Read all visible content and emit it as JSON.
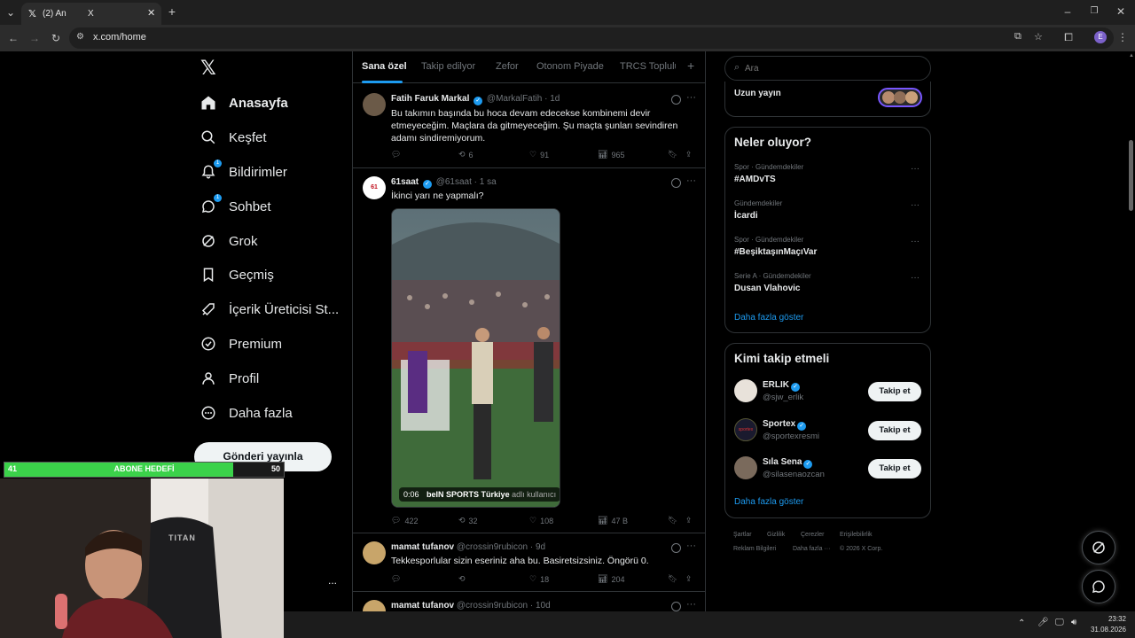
{
  "browser": {
    "tab_title": "(2) An",
    "tab_title_suffix": "X",
    "url": "x.com/home",
    "profile_initial": "E"
  },
  "nav": {
    "items": [
      {
        "label": "Anasayfa",
        "icon": "home-icon",
        "active": true
      },
      {
        "label": "Keşfet",
        "icon": "search-icon"
      },
      {
        "label": "Bildirimler",
        "icon": "bell-icon",
        "badge": "1"
      },
      {
        "label": "Sohbet",
        "icon": "chat-icon",
        "badge": "1"
      },
      {
        "label": "Grok",
        "icon": "grok-icon"
      },
      {
        "label": "Geçmiş",
        "icon": "bookmark-icon"
      },
      {
        "label": "İçerik Üreticisi St...",
        "icon": "rocket-icon"
      },
      {
        "label": "Premium",
        "icon": "premium-icon"
      },
      {
        "label": "Profil",
        "icon": "profile-icon"
      },
      {
        "label": "Daha fazla",
        "icon": "more-circle-icon"
      }
    ],
    "post_button": "Gönderi yayınla",
    "account_more": "..."
  },
  "feed_tabs": [
    "Sana özel",
    "Takip edilyor",
    "Zefor",
    "Otonom Piyade",
    "TRCS Toplulu"
  ],
  "tweets": [
    {
      "name": "Fatih Faruk Markal",
      "handle": "@MarkalFatih",
      "time": "· 1d",
      "text": "Bu takımın başında bu hoca devam edecekse kombinemi devir etmeyeceğim. Maçlara da gitmeyeceğim. Şu maçta şunları sevindiren adamı sindiremiyorum.",
      "replies": "",
      "retweets": "6",
      "likes": "91",
      "views": "965"
    },
    {
      "name": "61saat",
      "handle": "@61saat",
      "time": "· 1 sa",
      "text": "İkinci yarı ne yapmalı?",
      "video_time": "0:06",
      "video_credit": "beIN SPORTS Türkiye",
      "video_credit_suffix": "adlı kullanıcı",
      "replies": "422",
      "retweets": "32",
      "likes": "108",
      "views": "47 B"
    },
    {
      "name": "mamat tufanov",
      "handle": "@crossin9rubicon",
      "time": "· 9d",
      "text": "Tekkesporlular sizin eseriniz aha bu. Basiretsizsiniz. Öngörü 0.",
      "replies": "",
      "retweets": "",
      "likes": "18",
      "views": "204"
    },
    {
      "name": "mamat tufanov",
      "handle": "@crossin9rubicon",
      "time": "· 10d"
    }
  ],
  "right": {
    "search_placeholder": "Ara",
    "live_label": "Uzun yayın",
    "trends_title": "Neler oluyor?",
    "trends": [
      {
        "meta": "Spor · Gündemdekiler",
        "name": "#AMDvTS"
      },
      {
        "meta": "Gündemdekiler",
        "name": "İcardi"
      },
      {
        "meta": "Spor · Gündemdekiler",
        "name": "#BeşiktaşınMaçıVar"
      },
      {
        "meta": "Serie A · Gündemdekiler",
        "name": "Dusan Vlahovic"
      }
    ],
    "show_more": "Daha fazla göster",
    "who_title": "Kimi takip etmeli",
    "who": [
      {
        "name": "ERLIK",
        "handle": "@sjw_erlik",
        "button": "Takip et"
      },
      {
        "name": "Sportex",
        "handle": "@sportexresmi",
        "button": "Takip et"
      },
      {
        "name": "Sıla Sena",
        "handle": "@silasenaozcan",
        "button": "Takip et"
      }
    ],
    "footer": [
      "Şartlar",
      "Gizlilik",
      "Çerezler",
      "Erişilebilirlik",
      "Reklam Bilgileri",
      "Daha fazla ···",
      "© 2026 X Corp."
    ]
  },
  "overlay": {
    "abone_label": "ABONE HEDEFİ",
    "abone_current": "41",
    "abone_target": "50",
    "abone_progress": 0.82,
    "chair_brand": "TITAN"
  },
  "taskbar": {
    "time": "23:32",
    "date": "31.08.2026"
  },
  "colors": {
    "accent": "#1d9bf0",
    "progress": "#3bd24a"
  }
}
